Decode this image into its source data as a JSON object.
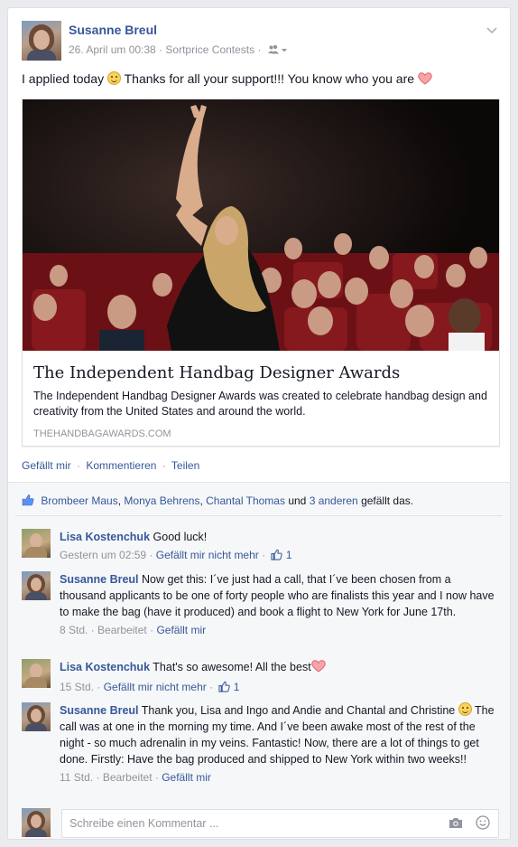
{
  "post": {
    "author": "Susanne Breul",
    "timestamp": "26. April um 00:38",
    "separator": "·",
    "group": "Sortprice Contests",
    "audience_icon": "friends-icon",
    "text_part1": "I applied today",
    "text_part2": "Thanks for all your support!!! You know who you are",
    "link_preview": {
      "title": "The Independent Handbag Designer Awards",
      "description": "The Independent Handbag Designer Awards was created to celebrate handbag design and creativity from the United States and around the world.",
      "domain": "THEHANDBAGAWARDS.COM"
    },
    "actions": {
      "like": "Gefällt mir",
      "comment": "Kommentieren",
      "share": "Teilen",
      "sep": "·"
    }
  },
  "likes_summary": {
    "name1": "Brombeer Maus",
    "comma1": ",",
    "name2": "Monya Behrens",
    "comma2": ",",
    "name3": "Chantal Thomas",
    "and": "und",
    "others": "3 anderen",
    "suffix": "gefällt das."
  },
  "comments": [
    {
      "author": "Lisa Kostenchuk",
      "text": "Good luck!",
      "time": "Gestern um 02:59",
      "sep": "·",
      "action": "Gefällt mir nicht mehr",
      "likes": "1"
    },
    {
      "author": "Susanne Breul",
      "text": "Now get this: I´ve just had a call, that I´ve been chosen from a thousand applicants to be one of forty people who are finalists this year and I now have to make the bag (have it produced) and book a flight to New York for June 17th.",
      "time": "8 Std.",
      "sep": "·",
      "edited": "Bearbeitet",
      "action": "Gefällt mir"
    },
    {
      "author": "Lisa Kostenchuk",
      "text": "That's so awesome! All the best",
      "time": "15 Std.",
      "sep": "·",
      "action": "Gefällt mir nicht mehr",
      "likes": "1"
    },
    {
      "author": "Susanne Breul",
      "text_part1": "Thank you, Lisa and Ingo and Andie and Chantal and Christine",
      "text_part2": "The call was at one in the morning my time. And I´ve been awake most of the rest of the night - so much adrenalin in my veins. Fantastic! Now, there are a lot of things to get done. Firstly: Have the bag produced and shipped to New York within two weeks!!",
      "time": "11 Std.",
      "sep": "·",
      "edited": "Bearbeitet",
      "action": "Gefällt mir"
    }
  ],
  "composer": {
    "placeholder": "Schreibe einen Kommentar ..."
  },
  "colors": {
    "link_blue": "#365899",
    "meta_gray": "#90949c",
    "page_bg": "#e9ebee"
  }
}
